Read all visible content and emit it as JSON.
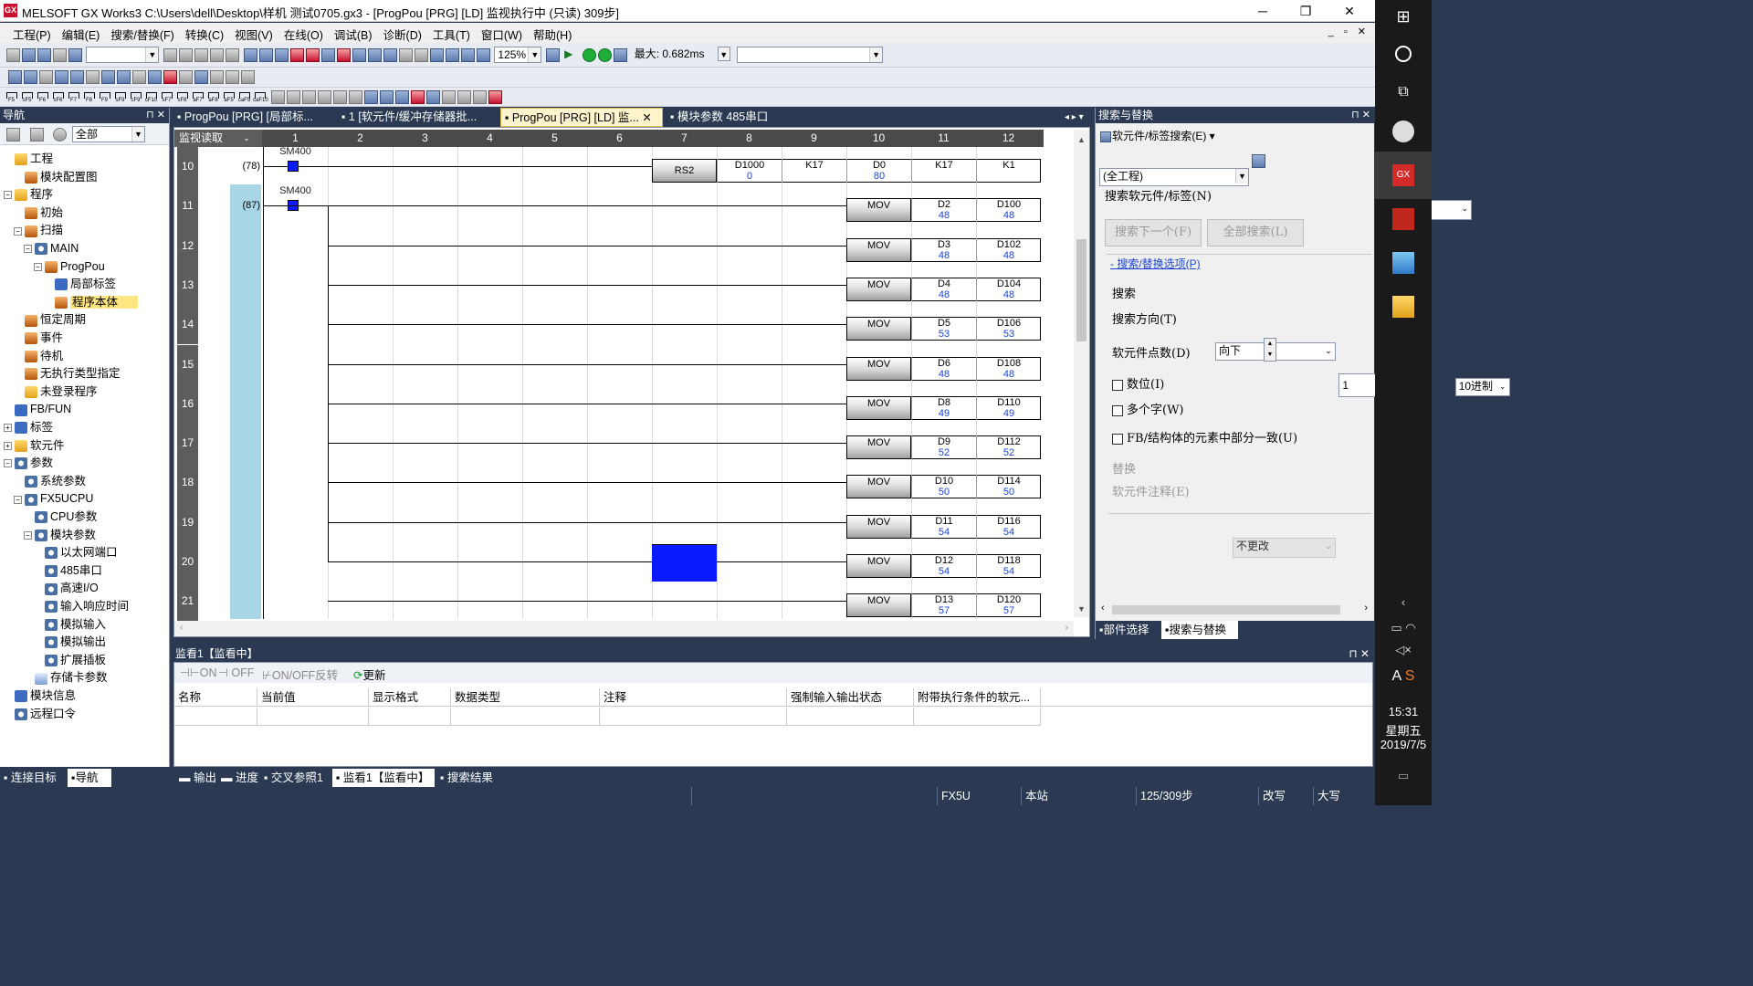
{
  "window": {
    "title": "MELSOFT GX Works3 C:\\Users\\dell\\Desktop\\样机 测试0705.gx3 - [ProgPou [PRG] [LD] 监视执行中 (只读) 309步]",
    "minimize": "─",
    "maximize": "❐",
    "close": "✕"
  },
  "menu": [
    "工程(P)",
    "编辑(E)",
    "搜索/替换(F)",
    "转换(C)",
    "视图(V)",
    "在线(O)",
    "调试(B)",
    "诊断(D)",
    "工具(T)",
    "窗口(W)",
    "帮助(H)"
  ],
  "mdi_controls": "_ ▫ ✕",
  "toolbar": {
    "zoom": "125%",
    "scan_time": "最大: 0.682ms",
    "fkeys": [
      "F5",
      "sF5",
      "F6",
      "sF6",
      "F7",
      "F8",
      "F9",
      "sF9",
      "cF9",
      "cF10",
      "sF7",
      "sF8",
      "aF7",
      "aF8",
      "aF5",
      "caF5",
      "caF10"
    ]
  },
  "nav": {
    "title": "导航",
    "filter": "全部",
    "tree": [
      {
        "label": "工程",
        "indent": 0,
        "toggle": "",
        "icon": "fold"
      },
      {
        "label": "模块配置图",
        "indent": 1,
        "toggle": "",
        "icon": "prog"
      },
      {
        "label": "程序",
        "indent": 0,
        "toggle": "−",
        "icon": "fold"
      },
      {
        "label": "初始",
        "indent": 1,
        "toggle": "",
        "icon": "prog"
      },
      {
        "label": "扫描",
        "indent": 1,
        "toggle": "−",
        "icon": "prog"
      },
      {
        "label": "MAIN",
        "indent": 2,
        "toggle": "−",
        "icon": "gear"
      },
      {
        "label": "ProgPou",
        "indent": 3,
        "toggle": "−",
        "icon": "prog"
      },
      {
        "label": "局部标签",
        "indent": 4,
        "toggle": "",
        "icon": "blue"
      },
      {
        "label": "程序本体",
        "indent": 4,
        "toggle": "",
        "icon": "prog",
        "selected": true
      },
      {
        "label": "恒定周期",
        "indent": 1,
        "toggle": "",
        "icon": "prog"
      },
      {
        "label": "事件",
        "indent": 1,
        "toggle": "",
        "icon": "prog"
      },
      {
        "label": "待机",
        "indent": 1,
        "toggle": "",
        "icon": "prog"
      },
      {
        "label": "无执行类型指定",
        "indent": 1,
        "toggle": "",
        "icon": "prog"
      },
      {
        "label": "未登录程序",
        "indent": 1,
        "toggle": "",
        "icon": "fold"
      },
      {
        "label": "FB/FUN",
        "indent": 0,
        "toggle": "",
        "icon": "blue"
      },
      {
        "label": "标签",
        "indent": 0,
        "toggle": "+",
        "icon": "blue"
      },
      {
        "label": "软元件",
        "indent": 0,
        "toggle": "+",
        "icon": "fold"
      },
      {
        "label": "参数",
        "indent": 0,
        "toggle": "−",
        "icon": "gear"
      },
      {
        "label": "系统参数",
        "indent": 1,
        "toggle": "",
        "icon": "gear"
      },
      {
        "label": "FX5UCPU",
        "indent": 1,
        "toggle": "−",
        "icon": "gear"
      },
      {
        "label": "CPU参数",
        "indent": 2,
        "toggle": "",
        "icon": "gear"
      },
      {
        "label": "模块参数",
        "indent": 2,
        "toggle": "−",
        "icon": "gear"
      },
      {
        "label": "以太网端口",
        "indent": 3,
        "toggle": "",
        "icon": "gear"
      },
      {
        "label": "485串口",
        "indent": 3,
        "toggle": "",
        "icon": "gear"
      },
      {
        "label": "高速I/O",
        "indent": 3,
        "toggle": "",
        "icon": "gear"
      },
      {
        "label": "输入响应时间",
        "indent": 3,
        "toggle": "",
        "icon": "gear"
      },
      {
        "label": "模拟输入",
        "indent": 3,
        "toggle": "",
        "icon": "gear"
      },
      {
        "label": "模拟输出",
        "indent": 3,
        "toggle": "",
        "icon": "gear"
      },
      {
        "label": "扩展插板",
        "indent": 3,
        "toggle": "",
        "icon": "gear"
      },
      {
        "label": "存储卡参数",
        "indent": 2,
        "toggle": "",
        "icon": "doc"
      },
      {
        "label": "模块信息",
        "indent": 0,
        "toggle": "",
        "icon": "blue"
      },
      {
        "label": "远程口令",
        "indent": 0,
        "toggle": "",
        "icon": "gear"
      }
    ],
    "tabs": [
      "连接目标",
      "导航"
    ]
  },
  "doc_tabs": [
    {
      "label": "ProgPou [PRG] [局部标..."
    },
    {
      "label": "1 [软元件/缓冲存储器批..."
    },
    {
      "label": "ProgPou [PRG] [LD] 监..."
    },
    {
      "label": "模块参数 485串口"
    }
  ],
  "ladder": {
    "read_mode": "监视读取",
    "columns": [
      "1",
      "2",
      "3",
      "4",
      "5",
      "6",
      "7",
      "8",
      "9",
      "10",
      "11",
      "12"
    ],
    "rung10": {
      "row": "10",
      "step": "(78)",
      "contact": "SM400",
      "instr": "RS2",
      "ops": [
        {
          "n": "D1000",
          "v": "0"
        },
        {
          "n": "K17",
          "v": ""
        },
        {
          "n": "D0",
          "v": "80"
        },
        {
          "n": "K17",
          "v": ""
        },
        {
          "n": "K1",
          "v": ""
        }
      ]
    },
    "rung11": {
      "row": "11",
      "step": "(87)",
      "contact": "SM400"
    },
    "movs": [
      {
        "row": "11",
        "instr": "MOV",
        "src": "D2",
        "sv": "48",
        "dst": "D100",
        "dv": "48"
      },
      {
        "row": "12",
        "instr": "MOV",
        "src": "D3",
        "sv": "48",
        "dst": "D102",
        "dv": "48"
      },
      {
        "row": "13",
        "instr": "MOV",
        "src": "D4",
        "sv": "48",
        "dst": "D104",
        "dv": "48"
      },
      {
        "row": "14",
        "instr": "MOV",
        "src": "D5",
        "sv": "53",
        "dst": "D106",
        "dv": "53"
      },
      {
        "row": "15",
        "instr": "MOV",
        "src": "D6",
        "sv": "48",
        "dst": "D108",
        "dv": "48"
      },
      {
        "row": "16",
        "instr": "MOV",
        "src": "D8",
        "sv": "49",
        "dst": "D110",
        "dv": "49"
      },
      {
        "row": "17",
        "instr": "MOV",
        "src": "D9",
        "sv": "52",
        "dst": "D112",
        "dv": "52"
      },
      {
        "row": "18",
        "instr": "MOV",
        "src": "D10",
        "sv": "50",
        "dst": "D114",
        "dv": "50"
      },
      {
        "row": "19",
        "instr": "MOV",
        "src": "D11",
        "sv": "54",
        "dst": "D116",
        "dv": "54"
      },
      {
        "row": "20",
        "instr": "MOV",
        "src": "D12",
        "sv": "54",
        "dst": "D118",
        "dv": "54"
      },
      {
        "row": "21",
        "instr": "MOV",
        "src": "D13",
        "sv": "57",
        "dst": "D120",
        "dv": "57"
      }
    ]
  },
  "search_panel": {
    "title": "搜索与替换",
    "mode": "软元件/标签搜索(E)",
    "scope": "(全工程)",
    "search_label": "搜索软元件/标签(N)",
    "find_next": "搜索下一个(F)",
    "find_all": "全部搜索(L)",
    "options_link": "- 搜索/替换选项(P)",
    "search_section": "搜索",
    "direction_label": "搜索方向(T)",
    "direction_value": "向下",
    "points_label": "软元件点数(D)",
    "points_value": "1",
    "radix": "10进制",
    "chk_bit": "数位(I)",
    "chk_multi": "多个字(W)",
    "chk_fb": "FB/结构体的元素中部分一致(U)",
    "replace_section": "替换",
    "comment_label": "软元件注释(E)",
    "comment_value": "不更改",
    "tabs": [
      "部件选择",
      "搜索与替换"
    ]
  },
  "watch": {
    "title": "监看1【监看中】",
    "tools": [
      "ON",
      "OFF",
      "ON/OFF反转",
      "更新"
    ],
    "columns": [
      "名称",
      "当前值",
      "显示格式",
      "数据类型",
      "注释",
      "强制输入输出状态",
      "附带执行条件的软元..."
    ]
  },
  "bottom_tabs": [
    "输出",
    "进度",
    "交叉参照1",
    "监看1【监看中】",
    "搜索结果"
  ],
  "status": [
    "FX5U",
    "本站",
    "125/309步",
    "改写",
    "大写"
  ],
  "taskbar": {
    "time": "15:31",
    "weekday": "星期五",
    "date": "2019/7/5",
    "ime": "A"
  }
}
